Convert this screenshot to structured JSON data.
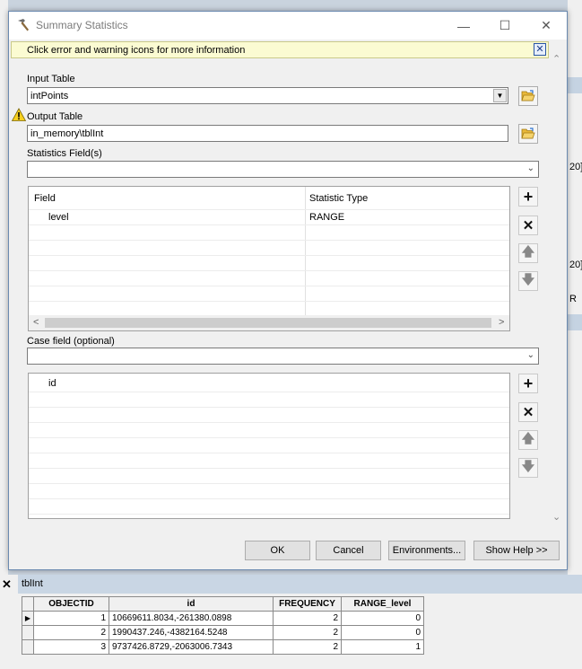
{
  "dialog": {
    "title": "Summary Statistics",
    "minimize_glyph": "—",
    "maximize_glyph": "☐",
    "close_glyph": "✕",
    "message": "Click error and warning icons for more information",
    "message_close_glyph": "✕"
  },
  "form": {
    "input_table": {
      "label": "Input Table",
      "value": "intPoints"
    },
    "output_table": {
      "label": "Output Table",
      "value": "in_memory\\tblInt"
    },
    "statistics_fields": {
      "label": "Statistics Field(s)",
      "value": "",
      "columns": [
        "Field",
        "Statistic Type"
      ],
      "rows": [
        {
          "field": "level",
          "statistic": "RANGE"
        }
      ]
    },
    "case_field": {
      "label": "Case field (optional)",
      "value": "",
      "items": [
        "id"
      ]
    }
  },
  "buttons": {
    "ok": "OK",
    "cancel": "Cancel",
    "environments": "Environments...",
    "show_help": "Show Help >>"
  },
  "icons": {
    "title_icon": "hammer-icon",
    "warning": "warning-icon",
    "folder": "open-folder-icon",
    "add": "plus-icon",
    "remove": "x-icon",
    "up": "arrow-up-icon",
    "down": "arrow-down-icon"
  },
  "background": {
    "right_fragment_1": "20]",
    "right_fragment_2": "20]",
    "right_fragment_3": "R"
  },
  "table_window": {
    "title": "tblInt",
    "columns": [
      "OBJECTID",
      "id",
      "FREQUENCY",
      "RANGE_level"
    ],
    "rows": [
      {
        "objectid": "1",
        "id": "10669611.8034,-261380.0898",
        "frequency": "2",
        "range_level": "0"
      },
      {
        "objectid": "2",
        "id": "1990437.246,-4382164.5248",
        "frequency": "2",
        "range_level": "0"
      },
      {
        "objectid": "3",
        "id": "9737426.8729,-2063006.7343",
        "frequency": "2",
        "range_level": "1"
      }
    ]
  },
  "colors": {
    "message_bg": "#fbfbd2",
    "table_title_bg": "#c9d6e4",
    "dialog_bg": "#f0f0f0"
  }
}
